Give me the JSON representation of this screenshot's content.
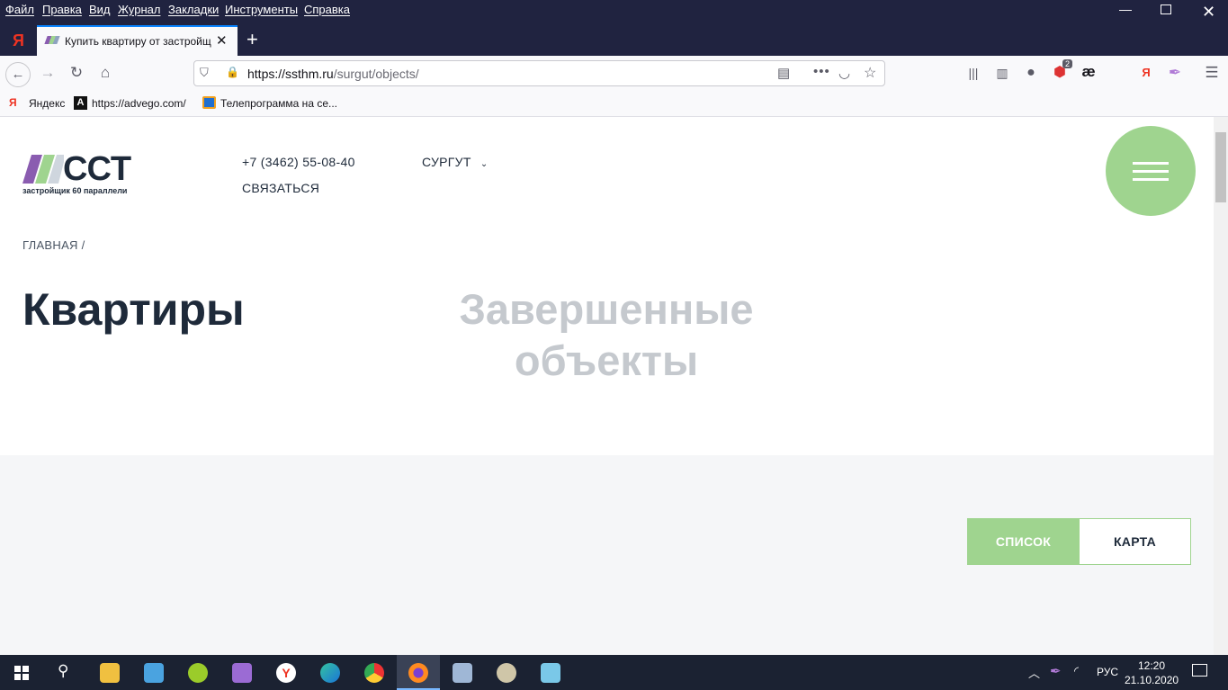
{
  "browser": {
    "menu": [
      "Файл",
      "Правка",
      "Вид",
      "Журнал",
      "Закладки",
      "Инструменты",
      "Справка"
    ],
    "tab_title": "Купить квартиру от застройщ",
    "url": {
      "host": "https://ssthm.ru",
      "path": "/surgut/objects/"
    },
    "bookmarks": [
      "Яндекс",
      "https://advego.com/",
      "Телепрограмма на се..."
    ],
    "badge_count": "2"
  },
  "site": {
    "logo_text": "CCT",
    "logo_sub": "застройщик 60 параллели",
    "phone": "+7 (3462) 55-08-40",
    "city": "СУРГУТ",
    "contact": "СВЯЗАТЬСЯ",
    "breadcrumb": "ГЛАВНАЯ",
    "breadcrumb_sep": "/",
    "page_title": "Квартиры",
    "subtitle_line1": "Завершенные",
    "subtitle_line2": "объекты",
    "view_list": "СПИСОК",
    "view_map": "КАРТА",
    "accent_color": "#9fd48f"
  },
  "taskbar": {
    "lang": "РУС",
    "time": "12:20",
    "date": "21.10.2020"
  }
}
